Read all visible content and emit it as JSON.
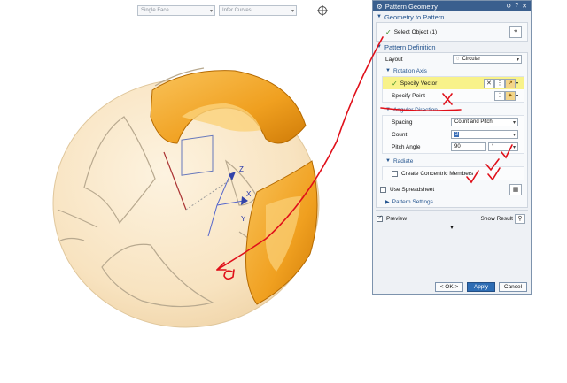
{
  "toolbar": {
    "filter_type": "Single Face",
    "curve_rule": "Infer Curves",
    "icons": [
      "more-dots-icon",
      "snap-target-icon"
    ]
  },
  "dialog": {
    "title": "Pattern Geometry",
    "title_icons": [
      "gear-icon",
      "reset-icon",
      "help-icon",
      "close-icon"
    ],
    "geometry_group": {
      "label": "Geometry to Pattern",
      "select_object": "Select Object (1)"
    },
    "definition_group": {
      "label": "Pattern Definition",
      "layout_label": "Layout",
      "layout_value": "Circular",
      "rotation_axis": {
        "label": "Rotation Axis",
        "specify_vector": "Specify Vector",
        "specify_point": "Specify Point"
      },
      "angular_direction": {
        "label": "Angular Direction",
        "spacing_label": "Spacing",
        "spacing_value": "Count and Pitch",
        "count_label": "Count",
        "count_value": "2",
        "pitch_label": "Pitch Angle",
        "pitch_value": "90",
        "pitch_unit": "°"
      },
      "radiate": {
        "label": "Radiate",
        "concentric": "Create Concentric Members"
      },
      "use_spreadsheet": "Use Spreadsheet",
      "pattern_settings": "Pattern Settings"
    },
    "preview_label": "Preview",
    "show_result": "Show Result",
    "buttons": {
      "ok": "< OK >",
      "apply": "Apply",
      "cancel": "Cancel"
    }
  },
  "viewport": {
    "triad_labels": {
      "z": "Z",
      "x": "X",
      "y": "Y"
    }
  },
  "colors": {
    "sphere": "#fbe9c9",
    "selected_face": "#f4a81c",
    "dialog_title": "#3a5f8e",
    "highlight": "#f8f28a",
    "annotation": "#e0101a"
  }
}
